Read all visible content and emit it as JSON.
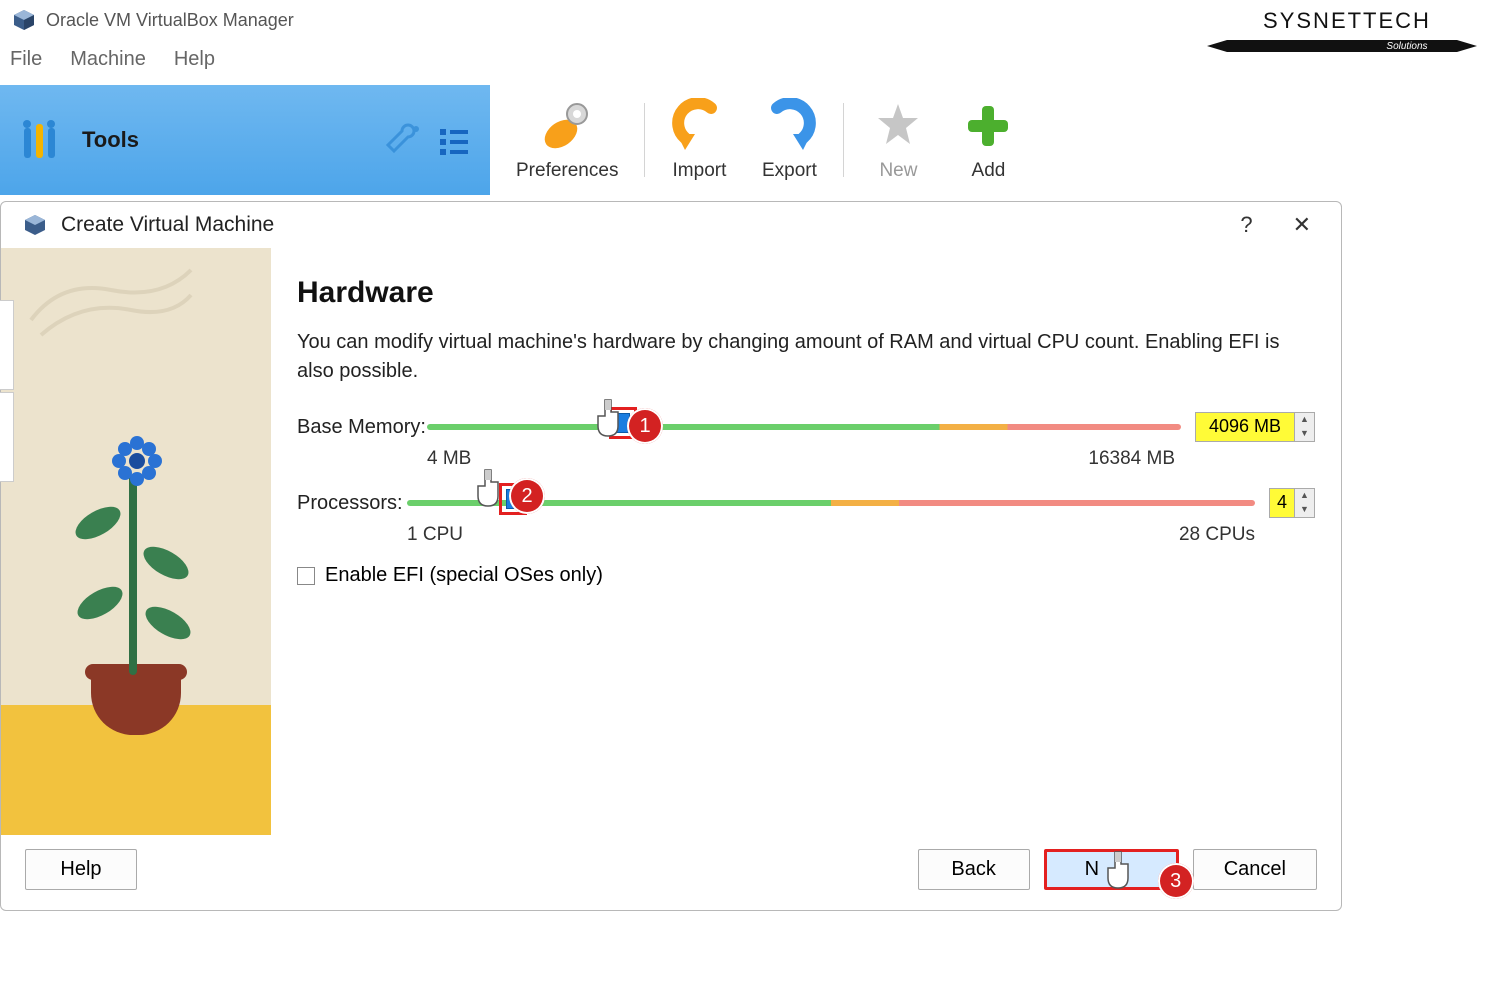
{
  "titlebar": {
    "title": "Oracle VM VirtualBox Manager"
  },
  "menu": {
    "file": "File",
    "machine": "Machine",
    "help": "Help"
  },
  "tools": {
    "label": "Tools"
  },
  "toolbar": {
    "preferences": "Preferences",
    "import": "Import",
    "export": "Export",
    "new": "New",
    "add": "Add"
  },
  "dialog": {
    "title": "Create Virtual Machine",
    "help_icon": "?",
    "close_icon": "✕",
    "heading": "Hardware",
    "description": "You can modify virtual machine's hardware by changing amount of RAM and virtual CPU count. Enabling EFI is also possible.",
    "memory": {
      "label": "Base Memory:",
      "min_label": "4 MB",
      "max_label": "16384 MB",
      "value": "4096 MB"
    },
    "processors": {
      "label": "Processors:",
      "min_label": "1 CPU",
      "max_label": "28 CPUs",
      "value": "4"
    },
    "efi_label": "Enable EFI (special OSes only)",
    "buttons": {
      "help": "Help",
      "back": "Back",
      "next": "Next",
      "cancel": "Cancel"
    }
  },
  "annotations": {
    "a1": "1",
    "a2": "2",
    "a3": "3"
  },
  "watermark": {
    "line1": "SYSNETTECH",
    "line2": "Solutions"
  }
}
